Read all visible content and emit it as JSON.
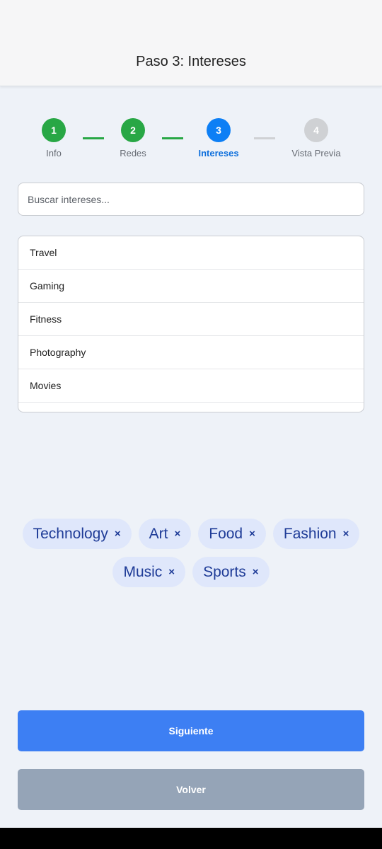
{
  "header": {
    "title": "Paso 3: Intereses"
  },
  "stepper": {
    "steps": [
      {
        "number": "1",
        "label": "Info",
        "state": "done"
      },
      {
        "number": "2",
        "label": "Redes",
        "state": "done"
      },
      {
        "number": "3",
        "label": "Intereses",
        "state": "active"
      },
      {
        "number": "4",
        "label": "Vista Previa",
        "state": "pending"
      }
    ]
  },
  "search": {
    "placeholder": "Buscar intereses..."
  },
  "options": [
    "Travel",
    "Gaming",
    "Fitness",
    "Photography",
    "Movies"
  ],
  "selected": {
    "remove_icon": "×",
    "chips": [
      "Technology",
      "Art",
      "Food",
      "Fashion",
      "Music",
      "Sports"
    ]
  },
  "buttons": {
    "next": "Siguiente",
    "back": "Volver"
  },
  "colors": {
    "done": "#28a745",
    "active": "#0d7ff5",
    "pending": "#cfd1d4",
    "primary_button": "#3d7ff3",
    "secondary_button": "#95a4b7",
    "chip_bg": "#dfe7fb",
    "chip_text": "#1e3b97"
  }
}
